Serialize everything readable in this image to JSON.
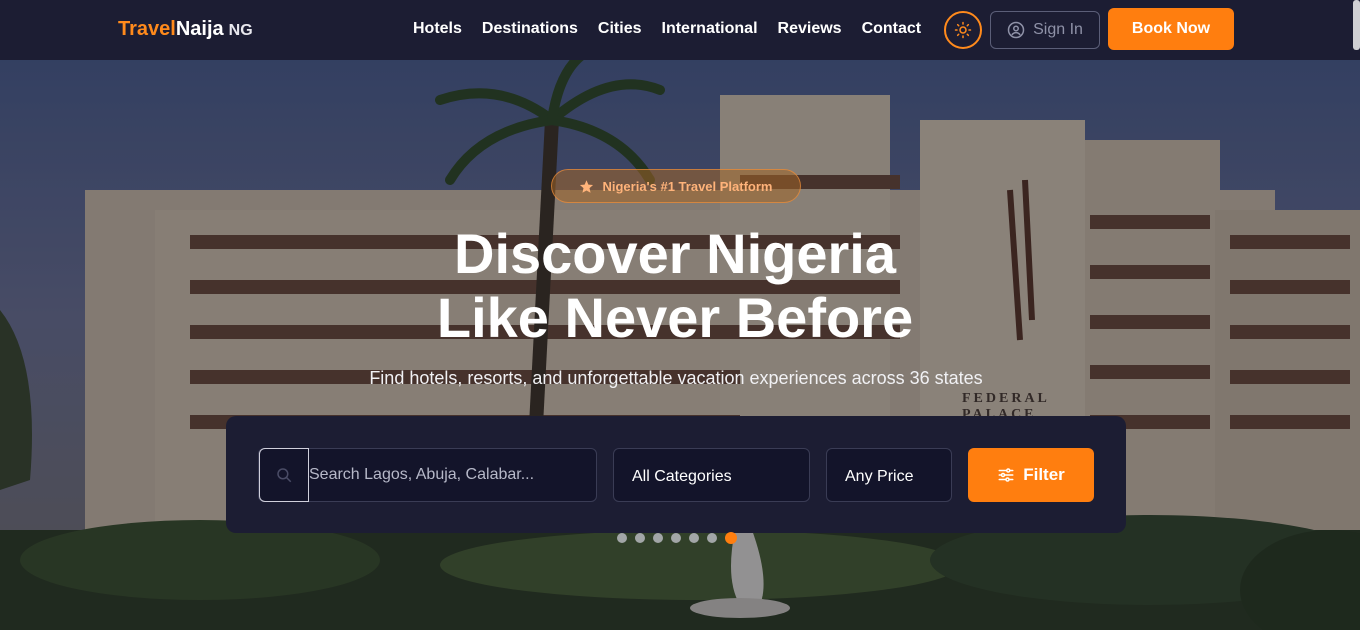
{
  "brand": {
    "name_part1": "Travel",
    "name_part2": "Naija",
    "suffix": "NG"
  },
  "nav": {
    "links": [
      "Hotels",
      "Destinations",
      "Cities",
      "International",
      "Reviews",
      "Contact"
    ],
    "signin_label": "Sign In",
    "book_label": "Book Now",
    "theme_icon": "sun-icon"
  },
  "hero": {
    "badge": "Nigeria's #1 Travel Platform",
    "title_line1": "Discover Nigeria",
    "title_line2": "Like Never Before",
    "subtitle": "Find hotels, resorts, and unforgettable vacation experiences across 36 states",
    "background_sign": "FEDERAL PALACE"
  },
  "search": {
    "placeholder": "Search Lagos, Abuja, Calabar...",
    "category_value": "All Categories",
    "price_value": "Any Price",
    "filter_label": "Filter"
  },
  "carousel": {
    "slide_count": 7,
    "active_index": 6
  },
  "colors": {
    "accent": "#ff7e0f",
    "nav_bg": "#1c1d33",
    "panel_bg": "#1c1d33"
  }
}
